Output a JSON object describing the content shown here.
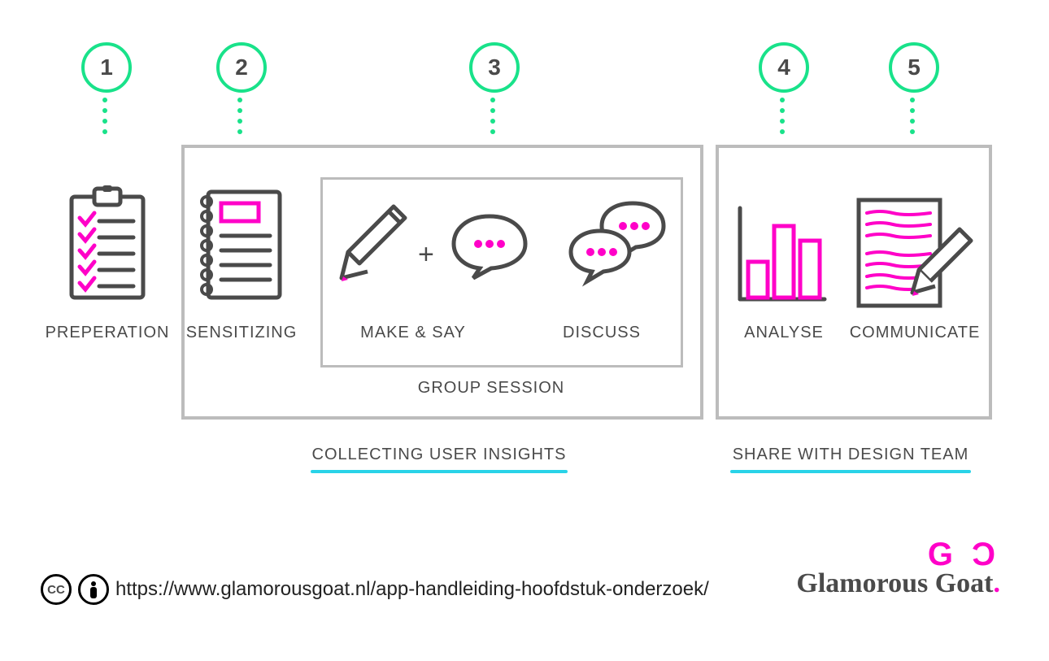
{
  "steps": {
    "s1": {
      "num": "1",
      "label": "PREPERATION"
    },
    "s2": {
      "num": "2",
      "label": "SENSITIZING"
    },
    "s3": {
      "num": "3",
      "label_a": "MAKE & SAY",
      "label_b": "DISCUSS",
      "group": "GROUP SESSION"
    },
    "s4": {
      "num": "4",
      "label": "ANALYSE"
    },
    "s5": {
      "num": "5",
      "label": "COMMUNICATE"
    }
  },
  "sections": {
    "collect": "COLLECTING USER INSIGHTS",
    "share": "SHARE WITH DESIGN TEAM"
  },
  "footer": {
    "url": "https://www.glamorousgoat.nl/app-handleiding-hoofdstuk-onderzoek/"
  },
  "brand": {
    "name": "Glamorous Goat"
  },
  "icons": {
    "clipboard": "clipboard-icon",
    "notebook": "notebook-icon",
    "pencil": "pencil-icon",
    "speech": "speech-bubble-icon",
    "discuss": "discussion-bubbles-icon",
    "barchart": "bar-chart-icon",
    "document": "document-pencil-icon",
    "cc": "cc-license-icon",
    "by": "attribution-icon",
    "logo": "glamorous-goat-logo"
  },
  "colors": {
    "green": "#19e28a",
    "magenta": "#ff00c8",
    "gray": "#4a4a4a",
    "cyan": "#29d3e8"
  }
}
